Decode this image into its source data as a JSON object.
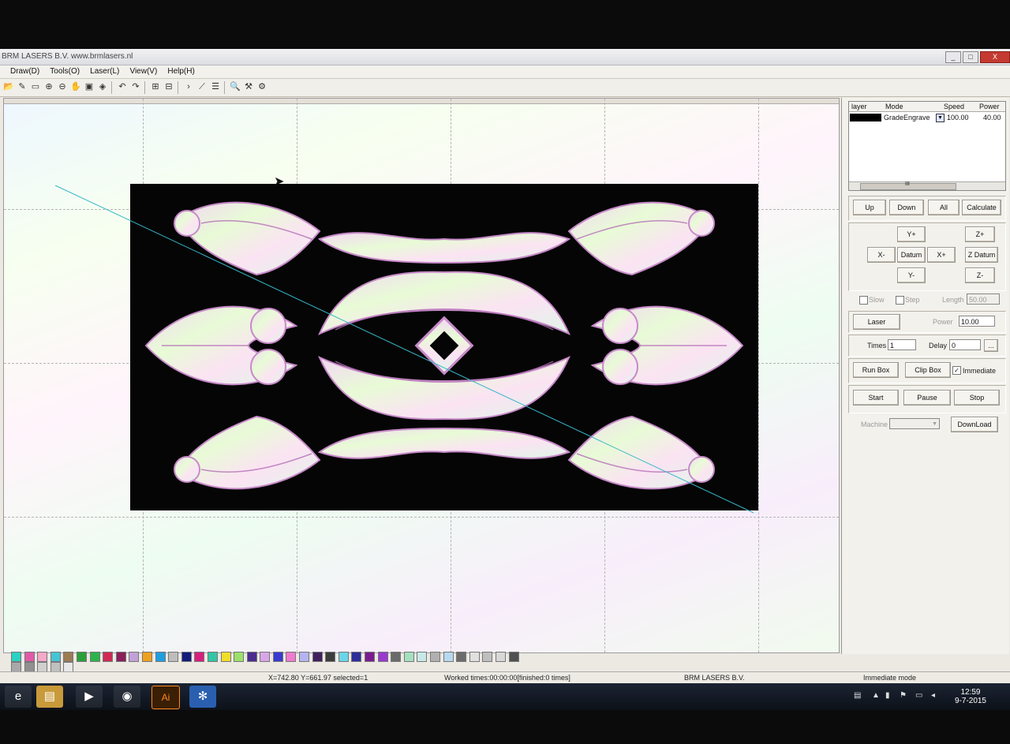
{
  "window": {
    "title": "BRM LASERS B.V. www.brmlasers.nl",
    "buttons": {
      "minimize": "_",
      "maximize": "□",
      "close": "X"
    }
  },
  "menu": [
    {
      "label": "Draw(D)"
    },
    {
      "label": "Tools(O)"
    },
    {
      "label": "Laser(L)"
    },
    {
      "label": "View(V)"
    },
    {
      "label": "Help(H)"
    }
  ],
  "toolbar_icons": [
    "folder-icon",
    "pen-icon",
    "select-icon",
    "zoom-in-icon",
    "zoom-out-icon",
    "pan-icon",
    "image-icon",
    "node-icon",
    "undo-icon",
    "redo-icon",
    "align-icon",
    "group-icon",
    "forward-icon",
    "line-tool-icon",
    "list-icon",
    "preview-icon",
    "laser-icon",
    "settings-icon"
  ],
  "toolbar_glyphs": [
    "📂",
    "✎",
    "▭",
    "⊕",
    "⊖",
    "✋",
    "▣",
    "◈",
    "↶",
    "↷",
    "⊞",
    "⊟",
    "›",
    "⟋",
    "☰",
    "🔍",
    "⚒",
    "⚙"
  ],
  "layers": {
    "headers": {
      "layer": "layer",
      "mode": "Mode",
      "speed": "Speed",
      "power": "Power"
    },
    "rows": [
      {
        "color": "#000000",
        "mode": "GradeEngrave",
        "speed": "100.00",
        "power": "40.00"
      }
    ],
    "scroll_label": "III"
  },
  "controls": {
    "up": "Up",
    "down": "Down",
    "all": "All",
    "calculate": "Calculate",
    "y_plus": "Y+",
    "x_minus": "X-",
    "datum": "Datum",
    "x_plus": "X+",
    "y_minus": "Y-",
    "z_plus": "Z+",
    "z_datum": "Z Datum",
    "z_minus": "Z-",
    "slow": "Slow",
    "step": "Step",
    "length_label": "Length",
    "length_value": "50.00",
    "laser": "Laser",
    "power_label": "Power",
    "power_value": "10.00",
    "times_label": "Times",
    "times_value": "1",
    "delay_label": "Delay",
    "delay_value": "0",
    "delay_button": "...",
    "run_box": "Run Box",
    "clip_box": "Clip Box",
    "immediate_label": "Immediate",
    "immediate_checked": true,
    "start": "Start",
    "pause": "Pause",
    "stop": "Stop",
    "machine_label": "Machine",
    "download": "DownLoad"
  },
  "palette": [
    "#2bd1c2",
    "#e25aa7",
    "#f5a8c8",
    "#47c4d4",
    "#9c7b55",
    "#2a9f3a",
    "#2cb34a",
    "#d02a54",
    "#8a1f5a",
    "#c2a1d7",
    "#f0a020",
    "#1e9fe0",
    "#bdbdbd",
    "#131d7a",
    "#d61f7d",
    "#32c6a5",
    "#f0de2a",
    "#9be06a",
    "#4b2d8f",
    "#d8a6e8",
    "#3a3acf",
    "#f07ad0",
    "#b4b4f0",
    "#41205e",
    "#3c3c3c",
    "#6ad4e8",
    "#2d2d9c",
    "#7a1c8f",
    "#9a3ad0",
    "#6a6a6a",
    "#a4e0c0",
    "#c8e8e8",
    "#b0b0b0",
    "#b8d8f0",
    "#6c6c6c",
    "#e0e0e0",
    "#bfbfbf",
    "#d8d8d8",
    "#505050",
    "#a8a8a8",
    "#909090",
    "#d0d0d0",
    "#c0c0c0",
    "#e8e8e8"
  ],
  "status": {
    "coords": "X=742.80 Y=661.97 selected=1",
    "worked": "Worked times:00:00:00[finished:0 times]",
    "company": "BRM LASERS B.V.",
    "mode": "Immediate mode"
  },
  "taskbar": {
    "apps": [
      {
        "name": "ie-icon",
        "glyph": "e"
      },
      {
        "name": "explorer-icon",
        "glyph": "▤"
      },
      {
        "name": "media-player-icon",
        "glyph": "▶"
      },
      {
        "name": "chrome-icon",
        "glyph": "◉"
      },
      {
        "name": "illustrator-icon",
        "glyph": "Ai"
      },
      {
        "name": "laser-app-icon",
        "glyph": "✻"
      }
    ],
    "time": "12:59",
    "date": "9-7-2015"
  }
}
